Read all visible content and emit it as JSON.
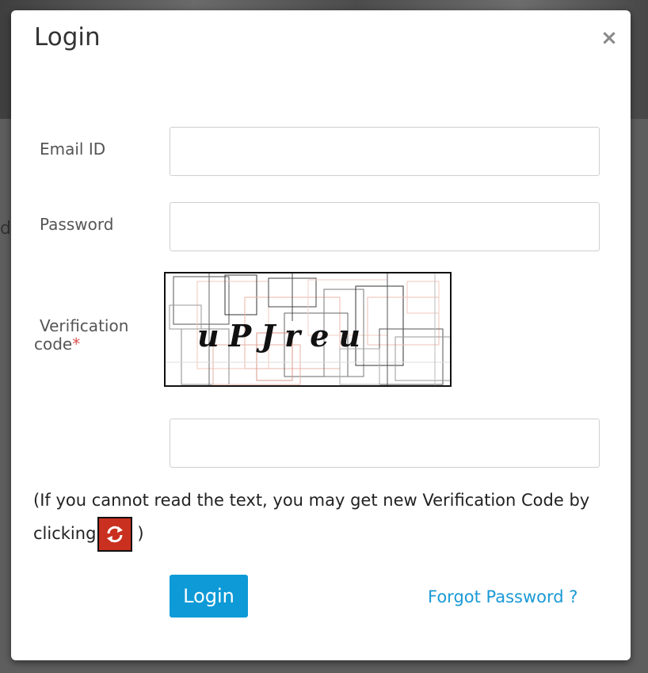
{
  "background": {
    "page_fragment": "d."
  },
  "modal": {
    "title": "Login",
    "close_symbol": "×",
    "close_icon": "close-icon"
  },
  "form": {
    "email_label": "Email ID",
    "email_value": "",
    "password_label": "Password",
    "password_value": "",
    "verification_label": "Verification code",
    "verification_label_line1": "Verification",
    "verification_label_line2": "code",
    "required_marker": "*",
    "captcha_text": "uPJreu",
    "captcha_input_value": ""
  },
  "help": {
    "text_before": "(If you cannot read the text, you may get new Verification Code by clicking",
    "text_after": ")",
    "refresh_icon": "refresh-icon"
  },
  "actions": {
    "login_label": "Login",
    "forgot_label": "Forgot Password ?"
  },
  "colors": {
    "primary": "#0e9ad7",
    "link": "#1a9ad6",
    "required": "#d9534f",
    "refresh_bg": "#c9301f"
  }
}
